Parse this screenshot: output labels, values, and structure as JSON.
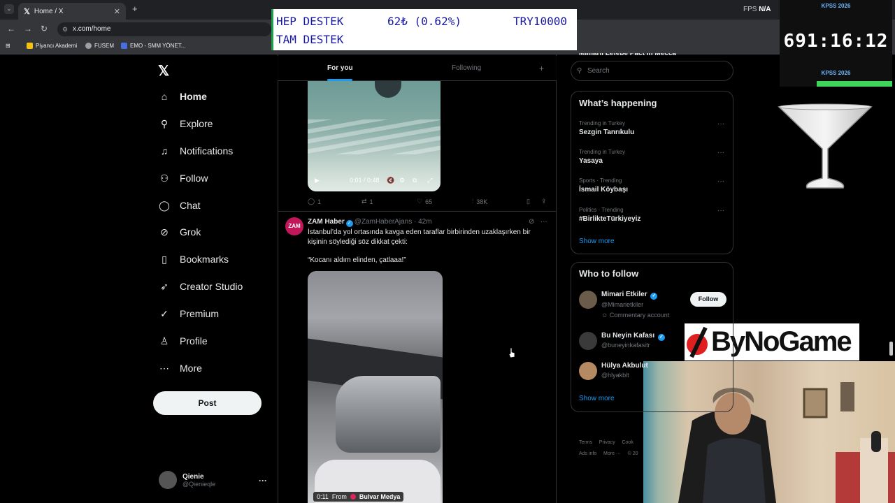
{
  "browser": {
    "tab_title": "Home / X",
    "tab_icon": "x-logo-icon",
    "url": "x.com/home",
    "fps_label": "FPS",
    "fps_value": "N/A",
    "bookmarks": [
      {
        "label": "Piyancı Akademi",
        "color": "#f4c20d"
      },
      {
        "label": "FUSEM",
        "color": "#9aa0a6"
      },
      {
        "label": "EMO - SMM YÖNET...",
        "color": "#4a6ee0"
      }
    ]
  },
  "overlay_ticker": {
    "line1_left": "HEP DESTEK",
    "line1_mid": "62₺ (0.62%)",
    "line1_right": "TRY10000",
    "line2_left": "TAM DESTEK"
  },
  "overlay_kpss": {
    "label_top": "KPSS 2026",
    "timer": "691:16:12",
    "label_bottom": "KPSS 2026"
  },
  "overlay_brand": {
    "text": "ByNoGame"
  },
  "sidebar": {
    "items": [
      {
        "label": "Home",
        "icon": "home-icon",
        "glyph": "⌂"
      },
      {
        "label": "Explore",
        "icon": "search-icon",
        "glyph": "⚲"
      },
      {
        "label": "Notifications",
        "icon": "bell-icon",
        "glyph": "♫"
      },
      {
        "label": "Follow",
        "icon": "person-add-icon",
        "glyph": "⚇"
      },
      {
        "label": "Chat",
        "icon": "chat-bubble-icon",
        "glyph": "◯"
      },
      {
        "label": "Grok",
        "icon": "grok-icon",
        "glyph": "⊘"
      },
      {
        "label": "Bookmarks",
        "icon": "bookmark-icon",
        "glyph": "▯"
      },
      {
        "label": "Creator Studio",
        "icon": "rocket-icon",
        "glyph": "➶"
      },
      {
        "label": "Premium",
        "icon": "verified-badge-icon",
        "glyph": "✓"
      },
      {
        "label": "Profile",
        "icon": "person-icon",
        "glyph": "♙"
      },
      {
        "label": "More",
        "icon": "more-circle-icon",
        "glyph": "⋯"
      }
    ],
    "post_label": "Post",
    "user_name": "Qienie",
    "user_handle": "@Qienieqle"
  },
  "feed": {
    "tabs": [
      "For you",
      "Following"
    ],
    "tweet1": {
      "video_time": "0:01 / 0:48",
      "replies": "1",
      "reposts": "1",
      "likes": "65",
      "views": "38K"
    },
    "tweet2": {
      "avatar_text": "ZAM",
      "name": "ZAM Haber",
      "handle": "@ZamHaberAjans",
      "time": "42m",
      "text": "İstanbul'da yol ortasında kavga eden taraflar birbirinden uzaklaşırken bir kişinin söylediği söz dikkat çekti:",
      "quote": "“Kocanı aldım elinden, çatlaaa!”",
      "video_time": "0:11",
      "from_label": "From",
      "source": "Bulvar Medya"
    }
  },
  "right": {
    "partial_heading": "Mimarlı Lefebe Pact in Mecca",
    "search_placeholder": "Search",
    "happening_title": "What’s happening",
    "trends": [
      {
        "category": "Trending in Turkey",
        "name": "Sezgin Tanrıkulu"
      },
      {
        "category": "Trending in Turkey",
        "name": "Yasaya"
      },
      {
        "category": "Sports · Trending",
        "name": "İsmail Köybaşı"
      },
      {
        "category": "Politics · Trending",
        "name": "#BirlikteTürkiyeyiz"
      }
    ],
    "show_more": "Show more",
    "wtf_title": "Who to follow",
    "wtf": [
      {
        "name": "Mimari Etkiler",
        "handle": "@Mimarietkiler",
        "extra": "Commentary account",
        "avatar_color": "#6b5b4b"
      },
      {
        "name": "Bu Neyin Kafası",
        "handle": "@buneyinkafasitr",
        "avatar_color": "#3a3a3a"
      },
      {
        "name": "Hülya Akbulut",
        "handle": "@hlyakblt",
        "avatar_color": "#b58a62"
      }
    ],
    "follow_label": "Follow",
    "wtf_show_more": "Show more",
    "footer_row1": [
      "Terms",
      "Privacy",
      "Cook"
    ],
    "footer_row2": [
      "Ads info",
      "More ···",
      "© 20"
    ]
  }
}
